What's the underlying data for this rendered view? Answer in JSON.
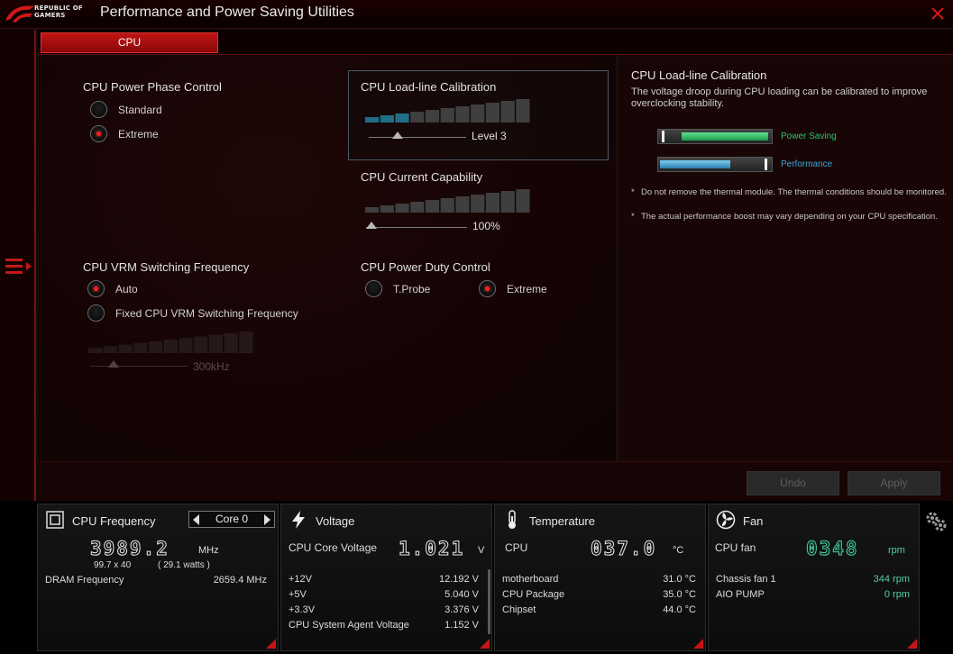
{
  "app": {
    "logo_line1": "REPUBLIC OF",
    "logo_line2": "GAMERS",
    "title": "Performance and Power Saving Utilities"
  },
  "tabs": [
    {
      "label": "CPU",
      "active": true
    }
  ],
  "colors": {
    "accent": "#c01414",
    "teal": "#4fd1a0",
    "blue": "#3aa6d8",
    "green": "#2ec36a"
  },
  "main": {
    "phase": {
      "title": "CPU Power Phase Control",
      "options": [
        "Standard",
        "Extreme"
      ],
      "selected": "Extreme"
    },
    "llc": {
      "title": "CPU Load-line Calibration",
      "value": "Level 3",
      "level_fraction": 0.3
    },
    "current": {
      "title": "CPU Current Capability",
      "value": "100%",
      "level_fraction": 0.0
    },
    "vrm": {
      "title": "CPU VRM Switching Frequency",
      "options": [
        "Auto",
        "Fixed CPU VRM Switching Frequency"
      ],
      "selected": "Auto",
      "value": "300kHz"
    },
    "duty": {
      "title": "CPU Power Duty Control",
      "options": [
        "T.Probe",
        "Extreme"
      ],
      "selected": "Extreme"
    }
  },
  "info": {
    "title": "CPU Load-line Calibration",
    "description": "The voltage droop during CPU loading can be calibrated to improve overclocking stability.",
    "legend": [
      {
        "label": "Power Saving",
        "color": "#2ec36a"
      },
      {
        "label": "Performance",
        "color": "#3aa6d8"
      }
    ],
    "notes": [
      "Do not remove the thermal module. The thermal conditions should be monitored.",
      "The actual performance boost may vary depending on your CPU specification."
    ]
  },
  "actions": {
    "undo": "Undo",
    "apply": "Apply"
  },
  "monitor": {
    "cpu_freq": {
      "title": "CPU Frequency",
      "core": "Core 0",
      "value": "3989.2",
      "unit": "MHz",
      "detail_ratio": "99.7  x  40",
      "detail_watts": "( 29.1   watts )",
      "dram_label": "DRAM Frequency",
      "dram_value": "2659.4  MHz"
    },
    "voltage": {
      "title": "Voltage",
      "main_label": "CPU Core Voltage",
      "main_value": "1.021",
      "main_unit": "V",
      "rows": [
        {
          "label": "+12V",
          "value": "12.192  V"
        },
        {
          "label": "+5V",
          "value": "5.040  V"
        },
        {
          "label": "+3.3V",
          "value": "3.376  V"
        },
        {
          "label": "CPU System Agent Voltage",
          "value": "1.152  V"
        }
      ]
    },
    "temperature": {
      "title": "Temperature",
      "main_label": "CPU",
      "main_value": "037.0",
      "main_unit": "°C",
      "rows": [
        {
          "label": "motherboard",
          "value": "31.0 °C"
        },
        {
          "label": "CPU Package",
          "value": "35.0 °C"
        },
        {
          "label": "Chipset",
          "value": "44.0 °C"
        }
      ]
    },
    "fan": {
      "title": "Fan",
      "main_label": "CPU fan",
      "main_value": "0348",
      "main_unit": "rpm",
      "rows": [
        {
          "label": "Chassis fan 1",
          "value": "344  rpm"
        },
        {
          "label": "AIO PUMP",
          "value": "0  rpm"
        }
      ]
    }
  }
}
